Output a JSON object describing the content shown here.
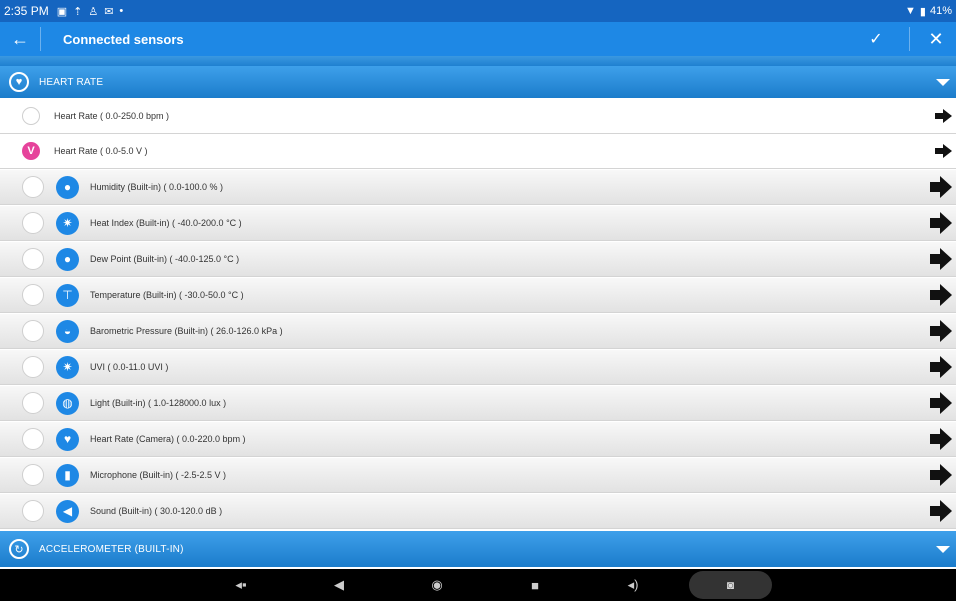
{
  "status_bar": {
    "time": "2:35 PM",
    "notification_icons": [
      "image-icon",
      "upload-icon",
      "person-icon",
      "mail-icon"
    ],
    "dot": "•",
    "battery": "41%"
  },
  "app_bar": {
    "title": "Connected sensors",
    "back_glyph": "←",
    "confirm_glyph": "✓",
    "close_glyph": "✕"
  },
  "groups": {
    "heart_rate": {
      "title": "HEART RATE"
    },
    "accelerometer": {
      "title": "ACCELEROMETER (BUILT-IN)"
    }
  },
  "heart_rate_options": [
    {
      "label": "Heart Rate ( 0.0-250.0 bpm )",
      "selected": false
    },
    {
      "label": "Heart Rate ( 0.0-5.0 V )",
      "selected": true,
      "badge": "V"
    }
  ],
  "sensors": [
    {
      "label": "Humidity (Built-in) ( 0.0-100.0 % )",
      "icon": "droplet-icon"
    },
    {
      "label": "Heat Index (Built-in) ( -40.0-200.0 °C )",
      "icon": "sun-icon"
    },
    {
      "label": "Dew Point (Built-in) ( -40.0-125.0 °C )",
      "icon": "droplet-icon"
    },
    {
      "label": "Temperature (Built-in) ( -30.0-50.0 °C )",
      "icon": "thermometer-icon"
    },
    {
      "label": "Barometric Pressure (Built-in) ( 26.0-126.0 kPa )",
      "icon": "gauge-icon"
    },
    {
      "label": "UVI ( 0.0-11.0 UVI )",
      "icon": "sun-icon"
    },
    {
      "label": "Light (Built-in) ( 1.0-128000.0 lux )",
      "icon": "lightbulb-icon"
    },
    {
      "label": "Heart Rate (Camera) ( 0.0-220.0 bpm )",
      "icon": "heart-icon"
    },
    {
      "label": "Microphone (Built-in) ( -2.5-2.5 V )",
      "icon": "microphone-icon"
    },
    {
      "label": "Sound (Built-in) ( 30.0-120.0 dB )",
      "icon": "speaker-icon"
    }
  ],
  "nav_bar": {
    "buttons": [
      "volume-down-icon",
      "back-icon",
      "home-icon",
      "recents-icon",
      "volume-up-icon",
      "screenshot-icon"
    ]
  },
  "colors": {
    "accent": "#1e88e5",
    "status_bar": "#1565c0",
    "selected_badge": "#e6439b"
  }
}
